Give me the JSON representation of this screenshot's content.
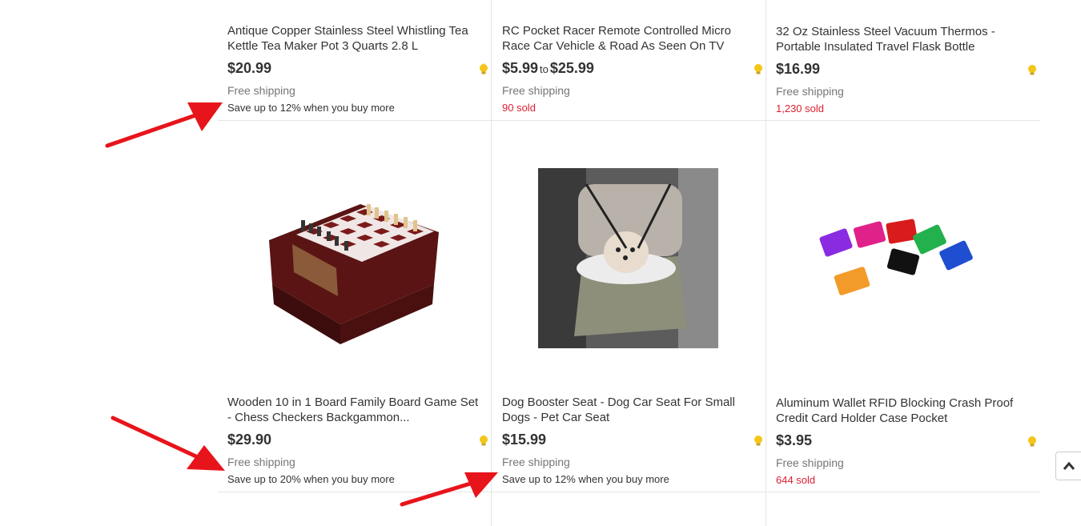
{
  "products": [
    {
      "title": "Antique Copper Stainless Steel Whistling Tea Kettle Tea Maker Pot 3 Quarts 2.8 L",
      "price": "$20.99",
      "shipping": "Free shipping",
      "extra": "Save up to 12% when you buy more"
    },
    {
      "title": "RC Pocket Racer Remote Controlled Micro Race Car Vehicle & Road As Seen On TV",
      "price_low": "$5.99",
      "price_to": "to",
      "price_high": "$25.99",
      "shipping": "Free shipping",
      "sold": "90 sold"
    },
    {
      "title": "32 Oz Stainless Steel Vacuum Thermos - Portable Insulated Travel Flask Bottle",
      "price": "$16.99",
      "shipping": "Free shipping",
      "sold": "1,230 sold"
    },
    {
      "title": "Wooden 10 in 1 Board Family Board Game Set - Chess Checkers Backgammon...",
      "price": "$29.90",
      "shipping": "Free shipping",
      "extra": "Save up to 20% when you buy more",
      "image_icon": "chess-board-image"
    },
    {
      "title": "Dog Booster Seat - Dog Car Seat For Small Dogs - Pet Car Seat",
      "price": "$15.99",
      "shipping": "Free shipping",
      "extra": "Save up to 12% when you buy more",
      "image_icon": "dog-car-seat-image"
    },
    {
      "title": "Aluminum Wallet RFID Blocking Crash Proof Credit Card Holder Case Pocket",
      "price": "$3.95",
      "shipping": "Free shipping",
      "sold": "644 sold",
      "image_icon": "card-wallets-image"
    }
  ],
  "colors": {
    "sold_red": "#dd1e31",
    "shipping_gray": "#767676",
    "arrow_red": "#e8141b",
    "divider": "#e5e5e5"
  },
  "icons": {
    "deal": "lightbulb-icon",
    "scroll_top": "chevron-up-icon",
    "annotation": "red-arrow"
  }
}
